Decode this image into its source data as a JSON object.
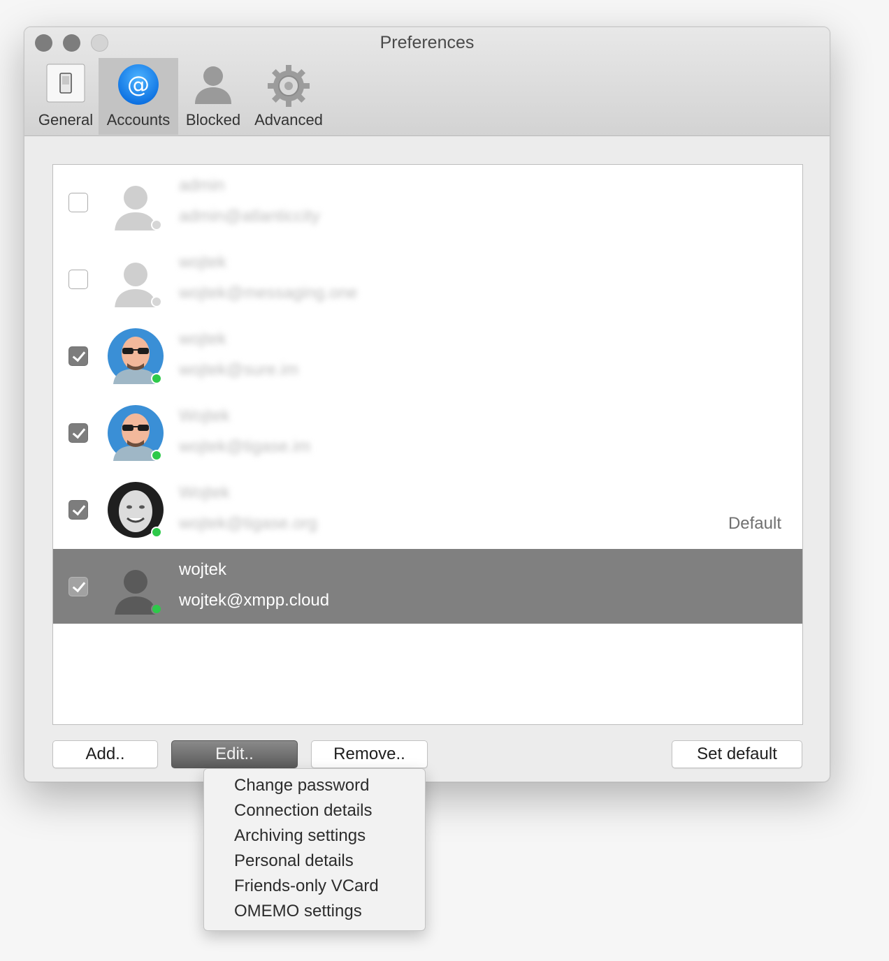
{
  "window": {
    "title": "Preferences"
  },
  "toolbar": {
    "tabs": [
      {
        "label": "General",
        "icon": "switch-icon",
        "active": false
      },
      {
        "label": "Accounts",
        "icon": "at-sign-icon",
        "active": true
      },
      {
        "label": "Blocked",
        "icon": "person-silhouette-icon",
        "active": false
      },
      {
        "label": "Advanced",
        "icon": "gear-icon",
        "active": false
      }
    ]
  },
  "accounts": [
    {
      "name": "admin",
      "jid": "admin@atlanticcity",
      "enabled": false,
      "status": "offline",
      "avatar": "default-avatar-icon",
      "blurred": true,
      "selected": false,
      "default_label": ""
    },
    {
      "name": "wojtek",
      "jid": "wojtek@messaging.one",
      "enabled": false,
      "status": "offline",
      "avatar": "default-avatar-icon",
      "blurred": true,
      "selected": false,
      "default_label": ""
    },
    {
      "name": "wojtek",
      "jid": "wojtek@sure.im",
      "enabled": true,
      "status": "online",
      "avatar": "cartoon-sunglasses-avatar",
      "blurred": true,
      "selected": false,
      "default_label": ""
    },
    {
      "name": "Wojtek",
      "jid": "wojtek@tigase.im",
      "enabled": true,
      "status": "online",
      "avatar": "cartoon-sunglasses-avatar",
      "blurred": true,
      "selected": false,
      "default_label": ""
    },
    {
      "name": "Wojtek",
      "jid": "wojtek@tigase.org",
      "enabled": true,
      "status": "online",
      "avatar": "bw-photo-avatar",
      "blurred": true,
      "selected": false,
      "default_label": "Default"
    },
    {
      "name": "wojtek",
      "jid": "wojtek@xmpp.cloud",
      "enabled": true,
      "status": "online",
      "avatar": "default-avatar-icon",
      "blurred": false,
      "selected": true,
      "default_label": ""
    }
  ],
  "buttons": {
    "add": "Add..",
    "edit": "Edit..",
    "remove": "Remove..",
    "set_default": "Set default"
  },
  "edit_menu": {
    "items": [
      "Change password",
      "Connection details",
      "Archiving settings",
      "Personal details",
      "Friends-only VCard",
      "OMEMO settings"
    ]
  },
  "colors": {
    "online": "#2ec94a",
    "offline": "#d6d6d6",
    "selection": "#808080",
    "accent_blue": "#1a8cf5"
  }
}
